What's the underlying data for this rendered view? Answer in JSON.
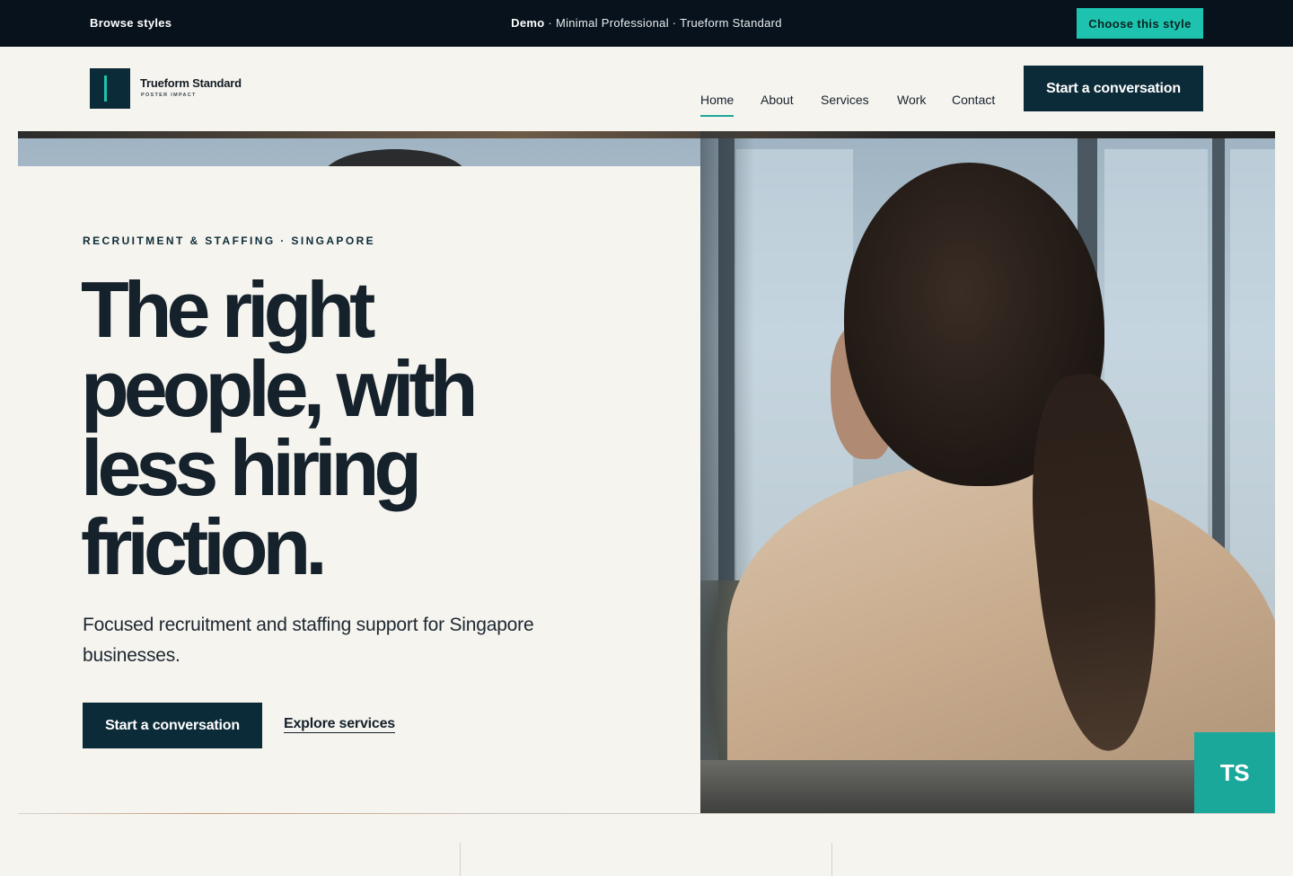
{
  "demo_bar": {
    "browse_label": "Browse styles",
    "demo_prefix": "Demo",
    "demo_path": " · Minimal Professional · Trueform Standard",
    "choose_label": "Choose this style",
    "accent_color": "#1ec3b0"
  },
  "header": {
    "logo_name": "Trueform Standard",
    "logo_tag": "POSTER IMPACT",
    "nav": [
      {
        "label": "Home",
        "active": true
      },
      {
        "label": "About",
        "active": false
      },
      {
        "label": "Services",
        "active": false
      },
      {
        "label": "Work",
        "active": false
      },
      {
        "label": "Contact",
        "active": false
      }
    ],
    "cta_label": "Start a conversation"
  },
  "hero": {
    "eyebrow": "RECRUITMENT & STAFFING · SINGAPORE",
    "headline": "The right people, with less hiring friction.",
    "subcopy": "Focused recruitment and staffing support for Singapore businesses.",
    "primary_cta": "Start a conversation",
    "secondary_link": "Explore services",
    "badge": "TS"
  },
  "colors": {
    "dark_brand": "#0c2b38",
    "teal": "#1aa89a",
    "background": "#f6f4ef",
    "demo_bar": "#08121c"
  }
}
